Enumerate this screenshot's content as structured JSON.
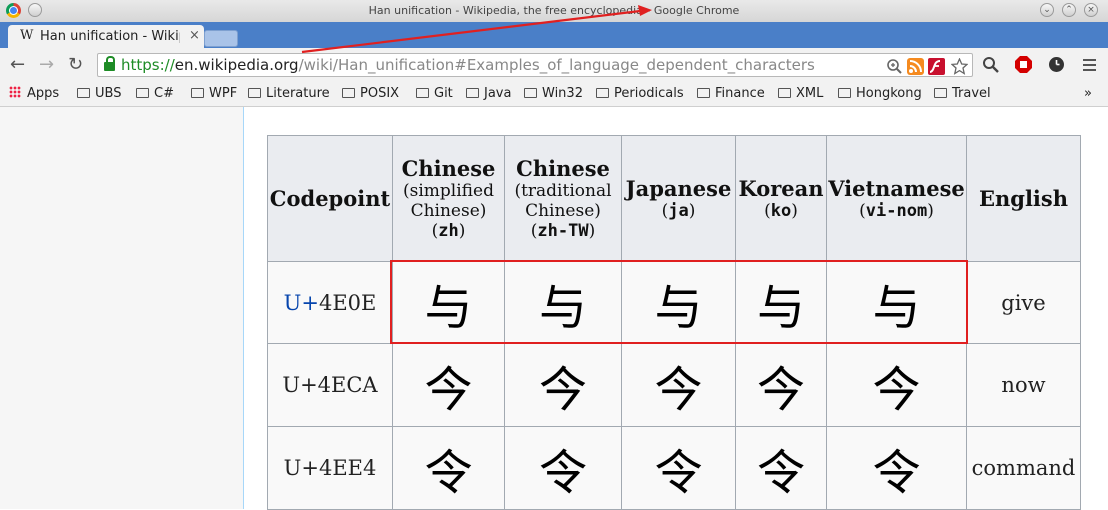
{
  "window": {
    "title": "Han unification - Wikipedia, the free encyclopedia - Google Chrome"
  },
  "tab": {
    "favicon": "W",
    "title": "Han unification - Wikipedia"
  },
  "address": {
    "scheme": "https://",
    "host": "en.wikipedia.org",
    "path": "/wiki/Han_unification#Examples_of_language_dependent_characters"
  },
  "bookmarks": [
    "Apps",
    "UBS",
    "C#",
    "WPF",
    "Literature",
    "POSIX",
    "Git",
    "Java",
    "Win32",
    "Periodicals",
    "Finance",
    "XML",
    "Hongkong",
    "Travel"
  ],
  "table": {
    "headers": {
      "codepoint": "Codepoint",
      "chinese": "Chinese",
      "simplified_1": "(simplified",
      "simplified_2": "Chinese)",
      "simplified_code": "zh",
      "traditional_1": "(traditional",
      "traditional_2": "Chinese)",
      "traditional_code": "zh-TW",
      "japanese": "Japanese",
      "japanese_code": "ja",
      "korean": "Korean",
      "korean_code": "ko",
      "vietnamese": "Vietnamese",
      "vietnamese_code": "vi-nom",
      "english": "English"
    },
    "rows": [
      {
        "prefix": "U+",
        "code": "4E0E",
        "chars": [
          "与",
          "与",
          "与",
          "与",
          "与"
        ],
        "english": "give"
      },
      {
        "prefix": "U+",
        "code": "4ECA",
        "chars": [
          "今",
          "今",
          "今",
          "今",
          "今"
        ],
        "english": "now"
      },
      {
        "prefix": "U+",
        "code": "4EE4",
        "chars": [
          "令",
          "令",
          "令",
          "令",
          "令"
        ],
        "english": "command"
      }
    ]
  },
  "colors": {
    "annotation": "#e02020",
    "link": "#0645ad",
    "tabstrip": "#4a7fc8"
  }
}
